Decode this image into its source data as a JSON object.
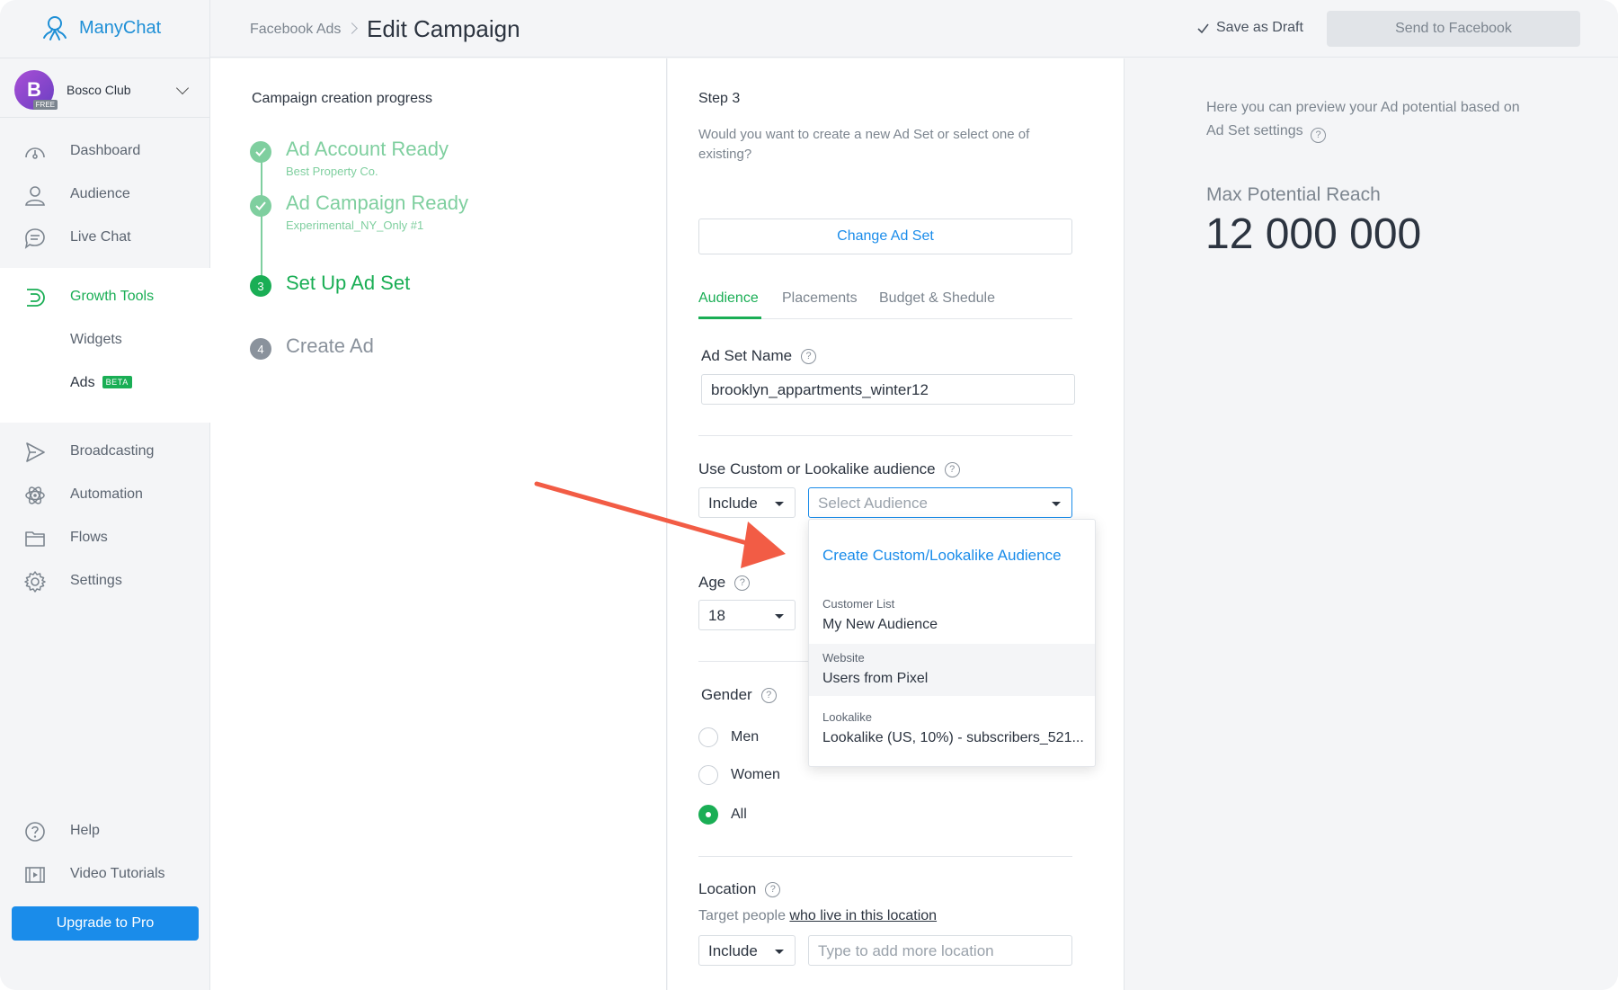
{
  "app": {
    "name": "ManyChat"
  },
  "account": {
    "name": "Bosco Club",
    "initial": "B",
    "plan_badge": "FREE"
  },
  "sidebar": {
    "items": [
      {
        "label": "Dashboard",
        "icon": "dashboard-icon"
      },
      {
        "label": "Audience",
        "icon": "user-icon"
      },
      {
        "label": "Live Chat",
        "icon": "chat-icon"
      },
      {
        "label": "Growth Tools",
        "icon": "growth-tools-icon"
      },
      {
        "label": "Widgets"
      },
      {
        "label": "Ads",
        "badge": "BETA"
      },
      {
        "label": "Broadcasting",
        "icon": "send-icon"
      },
      {
        "label": "Automation",
        "icon": "atom-icon"
      },
      {
        "label": "Flows",
        "icon": "folder-icon"
      },
      {
        "label": "Settings",
        "icon": "gear-icon"
      }
    ],
    "footer": [
      {
        "label": "Help",
        "icon": "help-icon"
      },
      {
        "label": "Video Tutorials",
        "icon": "film-icon"
      }
    ],
    "upgrade_label": "Upgrade to Pro"
  },
  "header": {
    "breadcrumb": "Facebook Ads",
    "title": "Edit Campaign",
    "save_draft_label": "Save as Draft",
    "send_label": "Send to Facebook"
  },
  "progress": {
    "title": "Campaign creation progress",
    "steps": [
      {
        "title": "Ad Account Ready",
        "subtitle": "Best Property Co.",
        "status": "done"
      },
      {
        "title": "Ad Campaign Ready",
        "subtitle": "Experimental_NY_Only #1",
        "status": "done"
      },
      {
        "number": "3",
        "title": "Set Up Ad Set",
        "status": "current"
      },
      {
        "number": "4",
        "title": "Create Ad",
        "status": "pending"
      }
    ]
  },
  "form": {
    "step_label": "Step 3",
    "description": "Would you want to create a new Ad Set or select one of existing?",
    "change_adset_label": "Change Ad Set",
    "tabs": [
      {
        "label": "Audience",
        "active": true
      },
      {
        "label": "Placements"
      },
      {
        "label": "Budget & Shedule"
      }
    ],
    "adset_name_label": "Ad Set Name",
    "adset_name_value": "brooklyn_appartments_winter12",
    "custom_audience_label": "Use Custom or Lookalike audience",
    "include_value": "Include",
    "audience_placeholder": "Select Audience",
    "age_label": "Age",
    "age_value": "18",
    "gender_label": "Gender",
    "gender_options": [
      {
        "label": "Men",
        "checked": false
      },
      {
        "label": "Women",
        "checked": false
      },
      {
        "label": "All",
        "checked": true
      }
    ],
    "location_label": "Location",
    "location_hint_prefix": "Target people",
    "location_hint_link": "who live in this location",
    "location_include_value": "Include",
    "location_placeholder": "Type to add more location"
  },
  "dropdown": {
    "create_label": "Create Custom/Lookalike Audience",
    "options": [
      {
        "category": "Customer List",
        "value": "My New Audience"
      },
      {
        "category": "Website",
        "value": "Users from Pixel",
        "highlighted": true
      },
      {
        "category": "Lookalike",
        "value": "Lookalike (US, 10%) - subscribers_521..."
      }
    ]
  },
  "preview": {
    "description": "Here you can preview your Ad potential based on Ad Set settings",
    "reach_label": "Max Potential Reach",
    "reach_value": "12 000 000"
  },
  "colors": {
    "accent_blue": "#1a8cea",
    "accent_green": "#1aae55",
    "annotation_arrow": "#f25c45"
  }
}
